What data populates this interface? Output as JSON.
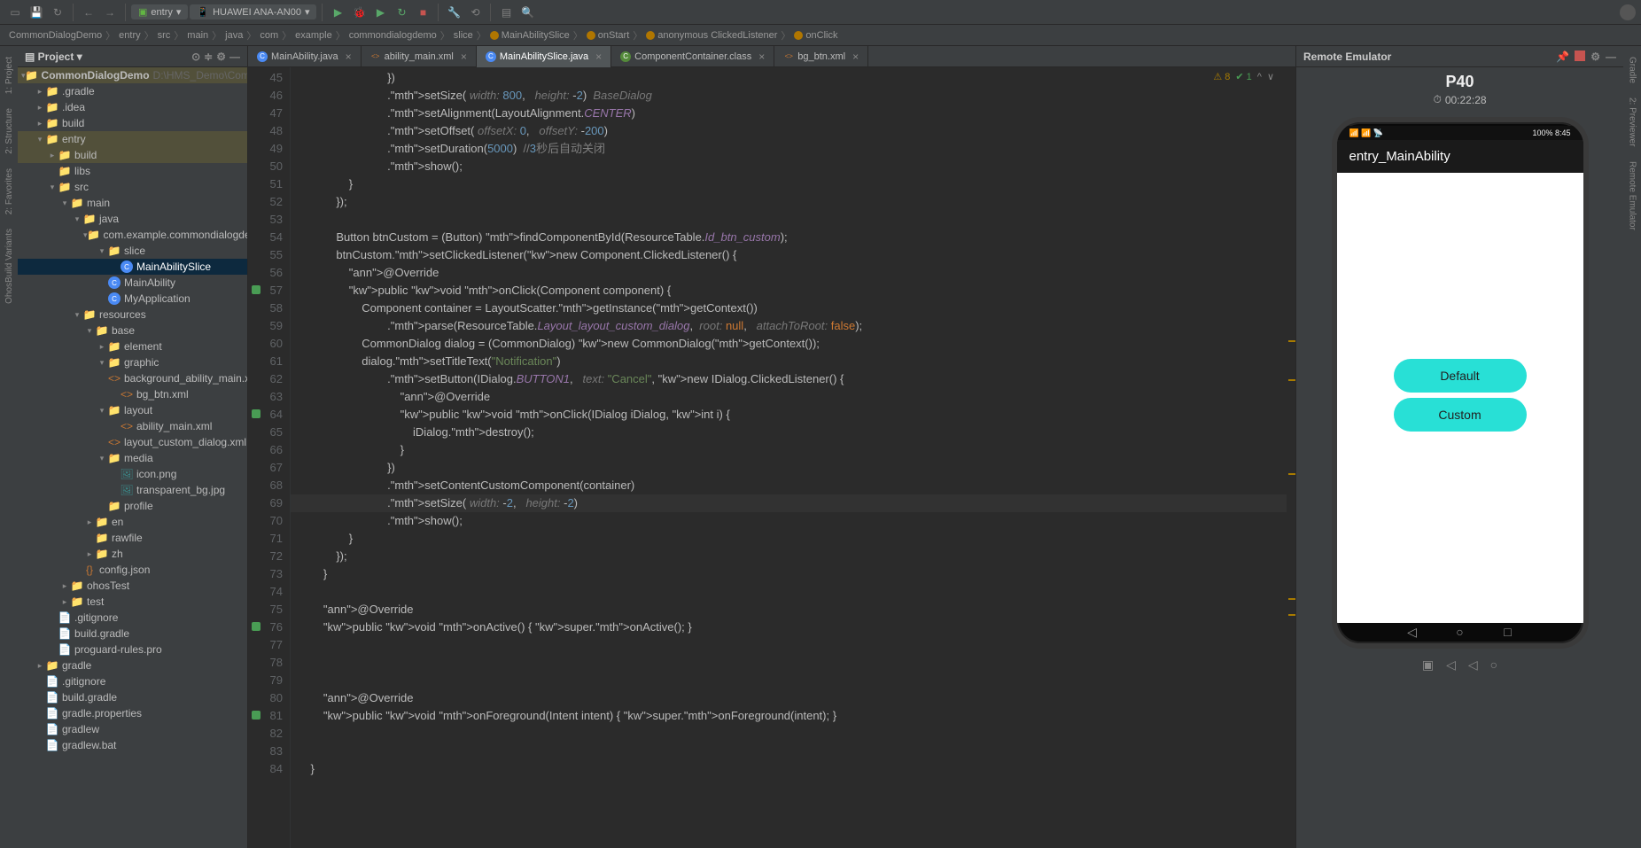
{
  "toolbar": {
    "run_config": "entry",
    "device": "HUAWEI ANA-AN00"
  },
  "breadcrumb": [
    "CommonDialogDemo",
    "entry",
    "src",
    "main",
    "java",
    "com",
    "example",
    "commondialogdemo",
    "slice",
    "MainAbilitySlice",
    "onStart",
    "anonymous ClickedListener",
    "onClick"
  ],
  "project": {
    "title": "Project",
    "root": "CommonDialogDemo",
    "root_path": "D:\\HMS_Demo\\Common"
  },
  "tree": [
    {
      "d": 0,
      "t": "CommonDialogDemo",
      "ico": "folder-b",
      "chev": "v",
      "hl": true,
      "path": "D:\\HMS_Demo\\Common"
    },
    {
      "d": 1,
      "t": ".gradle",
      "ico": "folder-o",
      "chev": ">"
    },
    {
      "d": 1,
      "t": ".idea",
      "ico": "folder-o",
      "chev": ">"
    },
    {
      "d": 1,
      "t": "build",
      "ico": "folder-o",
      "chev": ">"
    },
    {
      "d": 1,
      "t": "entry",
      "ico": "folder-b",
      "chev": "v",
      "hl": true
    },
    {
      "d": 2,
      "t": "build",
      "ico": "folder-o",
      "chev": ">",
      "hl": true
    },
    {
      "d": 2,
      "t": "libs",
      "ico": "folder"
    },
    {
      "d": 2,
      "t": "src",
      "ico": "folder",
      "chev": "v"
    },
    {
      "d": 3,
      "t": "main",
      "ico": "folder",
      "chev": "v"
    },
    {
      "d": 4,
      "t": "java",
      "ico": "folder-b",
      "chev": "v"
    },
    {
      "d": 5,
      "t": "com.example.commondialogdemo",
      "ico": "folder",
      "chev": "v"
    },
    {
      "d": 6,
      "t": "slice",
      "ico": "folder",
      "chev": "v"
    },
    {
      "d": 7,
      "t": "MainAbilitySlice",
      "ico": "cls",
      "sel": true
    },
    {
      "d": 6,
      "t": "MainAbility",
      "ico": "cls"
    },
    {
      "d": 6,
      "t": "MyApplication",
      "ico": "cls"
    },
    {
      "d": 4,
      "t": "resources",
      "ico": "folder",
      "chev": "v"
    },
    {
      "d": 5,
      "t": "base",
      "ico": "folder",
      "chev": "v"
    },
    {
      "d": 6,
      "t": "element",
      "ico": "folder",
      "chev": ">"
    },
    {
      "d": 6,
      "t": "graphic",
      "ico": "folder",
      "chev": "v"
    },
    {
      "d": 7,
      "t": "background_ability_main.xml",
      "ico": "xml"
    },
    {
      "d": 7,
      "t": "bg_btn.xml",
      "ico": "xml"
    },
    {
      "d": 6,
      "t": "layout",
      "ico": "folder",
      "chev": "v"
    },
    {
      "d": 7,
      "t": "ability_main.xml",
      "ico": "xml"
    },
    {
      "d": 7,
      "t": "layout_custom_dialog.xml",
      "ico": "xml"
    },
    {
      "d": 6,
      "t": "media",
      "ico": "folder",
      "chev": "v"
    },
    {
      "d": 7,
      "t": "icon.png",
      "ico": "img"
    },
    {
      "d": 7,
      "t": "transparent_bg.jpg",
      "ico": "img"
    },
    {
      "d": 6,
      "t": "profile",
      "ico": "folder"
    },
    {
      "d": 5,
      "t": "en",
      "ico": "folder",
      "chev": ">"
    },
    {
      "d": 5,
      "t": "rawfile",
      "ico": "folder"
    },
    {
      "d": 5,
      "t": "zh",
      "ico": "folder",
      "chev": ">"
    },
    {
      "d": 4,
      "t": "config.json",
      "ico": "json"
    },
    {
      "d": 3,
      "t": "ohosTest",
      "ico": "folder",
      "chev": ">"
    },
    {
      "d": 3,
      "t": "test",
      "ico": "folder",
      "chev": ">"
    },
    {
      "d": 2,
      "t": ".gitignore",
      "ico": "file"
    },
    {
      "d": 2,
      "t": "build.gradle",
      "ico": "file"
    },
    {
      "d": 2,
      "t": "proguard-rules.pro",
      "ico": "file"
    },
    {
      "d": 1,
      "t": "gradle",
      "ico": "folder",
      "chev": ">"
    },
    {
      "d": 1,
      "t": ".gitignore",
      "ico": "file"
    },
    {
      "d": 1,
      "t": "build.gradle",
      "ico": "file"
    },
    {
      "d": 1,
      "t": "gradle.properties",
      "ico": "file"
    },
    {
      "d": 1,
      "t": "gradlew",
      "ico": "file"
    },
    {
      "d": 1,
      "t": "gradlew.bat",
      "ico": "file"
    }
  ],
  "tabs": [
    {
      "label": "MainAbility.java",
      "ico": "java",
      "close": true
    },
    {
      "label": "ability_main.xml",
      "ico": "xml",
      "close": true
    },
    {
      "label": "MainAbilitySlice.java",
      "ico": "java",
      "active": true,
      "close": true
    },
    {
      "label": "ComponentContainer.class",
      "ico": "cls",
      "close": true
    },
    {
      "label": "bg_btn.xml",
      "ico": "xml",
      "close": true
    }
  ],
  "code": {
    "start": 45,
    "lines": [
      "                            })",
      "                            .setSize( width: 800,   height: -2)  BaseDialog",
      "                            .setAlignment(LayoutAlignment.CENTER)",
      "                            .setOffset( offsetX: 0,   offsetY: -200)",
      "                            .setDuration(5000)  //3秒后自动关闭",
      "                            .show();",
      "                }",
      "            });",
      "",
      "            Button btnCustom = (Button) findComponentById(ResourceTable.Id_btn_custom);",
      "            btnCustom.setClickedListener(new Component.ClickedListener() {",
      "                @Override",
      "                public void onClick(Component component) {",
      "                    Component container = LayoutScatter.getInstance(getContext())",
      "                            .parse(ResourceTable.Layout_layout_custom_dialog,  root: null,   attachToRoot: false);",
      "                    CommonDialog dialog = (CommonDialog) new CommonDialog(getContext());",
      "                    dialog.setTitleText(\"Notification\")",
      "                            .setButton(IDialog.BUTTON1,   text: \"Cancel\", new IDialog.ClickedListener() {",
      "                                @Override",
      "                                public void onClick(IDialog iDialog, int i) {",
      "                                    iDialog.destroy();",
      "                                }",
      "                            })",
      "                            .setContentCustomComponent(container)",
      "                            .setSize( width: -2,   height: -2)",
      "                            .show();",
      "                }",
      "            });",
      "        }",
      "",
      "        @Override",
      "        public void onActive() { super.onActive(); }",
      "",
      "",
      "",
      "        @Override",
      "        public void onForeground(Intent intent) { super.onForeground(intent); }",
      "",
      "",
      "    }"
    ]
  },
  "inspections": {
    "warnings": "8",
    "pass": "1"
  },
  "emulator": {
    "title": "Remote Emulator",
    "device": "P40",
    "elapsed": "00:22:28",
    "app_title": "entry_MainAbility",
    "status_right": "100%  8:45",
    "btn_default": "Default",
    "btn_custom": "Custom"
  },
  "lstrip": [
    "1: Project",
    "2: Structure",
    "2: Favorites",
    "OhosBuild Variants"
  ],
  "rstrip": [
    "Gradle",
    "2: Previewer",
    "Remote Emulator"
  ]
}
